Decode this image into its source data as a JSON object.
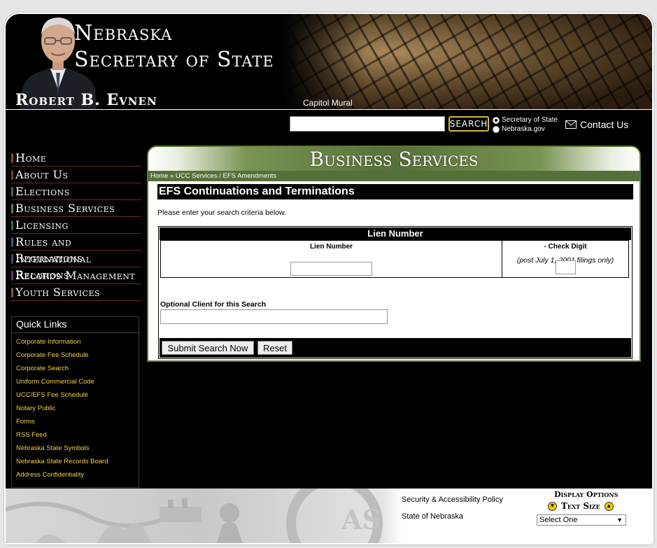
{
  "header": {
    "title_line1": "Nebraska",
    "title_line2": "Secretary of State",
    "official_name": "Robert B. Evnen",
    "mural_label": "Capitol Mural"
  },
  "search": {
    "value": "",
    "button_label": "SEARCH",
    "scope_options": [
      {
        "label": "Secretary of State",
        "selected": true
      },
      {
        "label": "Nebraska.gov",
        "selected": false
      }
    ]
  },
  "contact": {
    "label": "Contact Us"
  },
  "nav": {
    "items": [
      {
        "label": "Home",
        "color": "#8a4a2a"
      },
      {
        "label": "About Us",
        "color": "#7a3a3a"
      },
      {
        "label": "Elections",
        "color": "#4a6a3a"
      },
      {
        "label": "Business Services",
        "color": "#6a7a3a"
      },
      {
        "label": "Licensing",
        "color": "#3a6a4a"
      },
      {
        "label": "Rules and Regulations",
        "color": "#3a5a7a"
      },
      {
        "label": "International Relations",
        "color": "#4a4a7a"
      },
      {
        "label": "Records Management",
        "color": "#6a3a6a"
      },
      {
        "label": "Youth Services",
        "color": "#7a5a3a"
      }
    ]
  },
  "quick_links": {
    "title": "Quick Links",
    "items": [
      "Corporate Information",
      "Corporate Fee Schedule",
      "Corporate Search",
      "Uniform Commercial Code",
      "UCC/EFS Fee Schedule",
      "Notary Public",
      "Forms",
      "RSS Feed",
      "Nebraska State Symbols",
      "Nebraska State Records Board",
      "Address Confidentiality"
    ],
    "link_color": "#f0d048"
  },
  "content": {
    "section_title": "Business Services",
    "breadcrumb": {
      "home": "Home",
      "sep1": " » ",
      "ucc": "UCC Services",
      "sep2": " / ",
      "current": "EFS Amendments"
    },
    "page_title": "EFS Continuations and Terminations",
    "instructions": "Please enter your search criteria below.",
    "form": {
      "header": "Lien Number",
      "lien_label": "Lien Number",
      "lien_value": "",
      "check_digit_label": "- Check Digit",
      "check_digit_note": "(post July 1, 2001 filings only)",
      "check_digit_value": "",
      "optional_label": "Optional Client for this Search",
      "optional_value": "",
      "submit_label": "Submit Search Now",
      "reset_label": "Reset"
    }
  },
  "footer": {
    "links": [
      "Security & Accessibility Policy",
      "State of Nebraska"
    ],
    "display_options_title": "Display Options",
    "text_size_label": "Text Size",
    "select_value": "Select One"
  },
  "colors": {
    "accent_green": "#56703a",
    "gold": "#f0d048"
  }
}
